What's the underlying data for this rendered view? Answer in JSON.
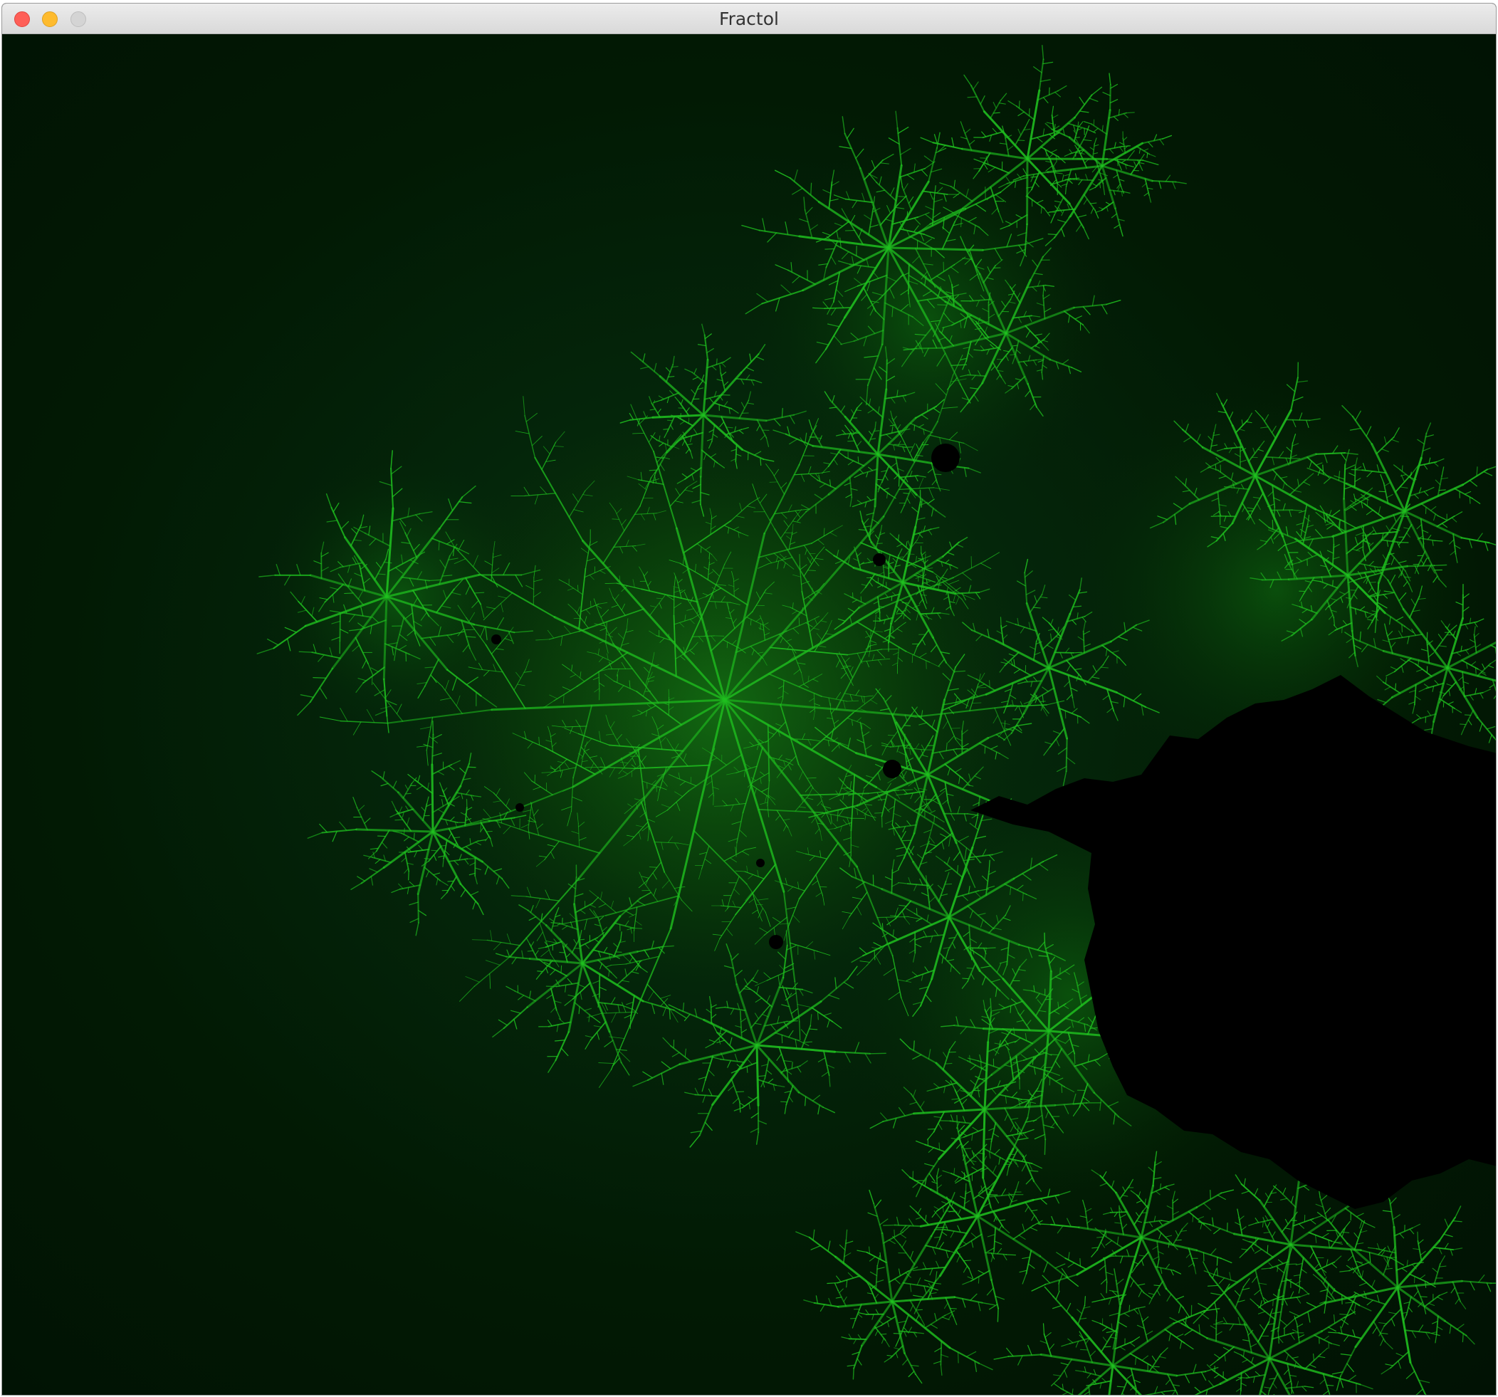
{
  "window": {
    "title": "Fractol",
    "background_color": "#011204",
    "fractal_color": "#1fbf1f",
    "interior_color": "#000000"
  },
  "traffic_lights": {
    "close_color": "#fe5f57",
    "minimize_color": "#febb2e",
    "zoom_color": "#d4d4d4"
  }
}
